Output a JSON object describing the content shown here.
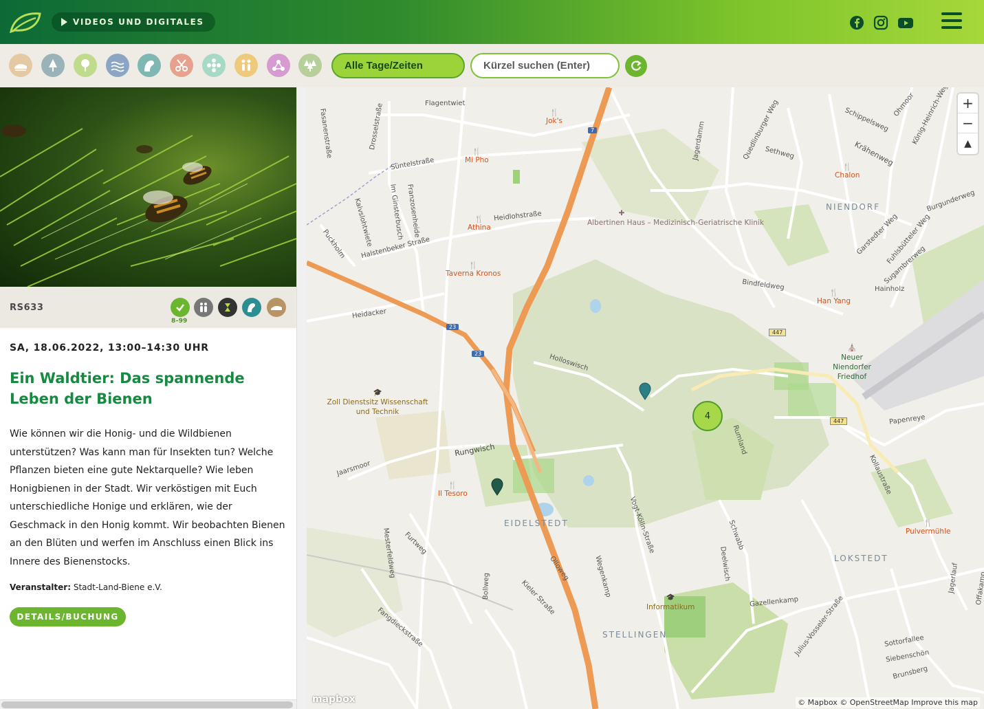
{
  "header": {
    "video_label": "VIDEOS UND DIGITALES"
  },
  "filters": {
    "days_label": "Alle Tage/Zeiten",
    "search_placeholder": "Kürzel suchen (Enter)"
  },
  "event": {
    "code": "RS633",
    "age_range": "8–99",
    "date": "SA, 18.06.2022, 13:00–14:30 UHR",
    "title": "Ein Waldtier: Das spannende Leben der Bienen",
    "description": "Wie können wir die Honig- und die Wildbienen unterstützen? Was kann man für Insekten tun? Welche Pflanzen bieten eine gute Nektarquelle? Wie leben Honigbienen in der Stadt. Wir verköstigen mit Euch unterschiedliche Honige und erklären, wie der Geschmack in den Honig kommt. Wir beobachten Bienen an den Blüten und werfen im Anschluss einen Blick ins Innere des Bienenstocks.",
    "organizer_label": "Veranstalter:",
    "organizer": "Stadt-Land-Biene e.V.",
    "details_button": "DETAILS/BUCHUNG"
  },
  "map": {
    "cluster_count": "4",
    "streets": [
      "Flagentwiet",
      "Fasanenstraße",
      "Drosselstraße",
      "Süntelstraße",
      "Im Ginsterbusch",
      "Franzosenheide",
      "Kalvslohtwiete",
      "Puckholm",
      "Halstenbeker Straße",
      "Heidlohstraße",
      "Heidacker",
      "Holloswisch",
      "Rungwisch",
      "Jaarsmoor",
      "Furtweg",
      "Mesterfeldweg",
      "Bollweg",
      "Fangdieckstraße",
      "Kieler Straße",
      "Olloweg",
      "Wegenkamp",
      "Vogt-Kölln-Straße",
      "Schwabb",
      "Deelwisch",
      "Gazellenkamp",
      "Julius-Vosseler-Straße",
      "Rumland",
      "Papenreye",
      "Kollaustraße",
      "Bindfeldweg",
      "Jagerdamm",
      "Quedlinburger Weg",
      "Sethweg",
      "Schippelsweg",
      "Krähenweg",
      "Ohmoor",
      "König-Heinrich-Weg",
      "Garstedter Weg",
      "Burgunderweg",
      "Fuhlsbütteler Weg",
      "Sugambrerweg",
      "Hainholz",
      "Sottorfallee",
      "Siebenschön",
      "Brunsberg",
      "Jagerlauf",
      "Offakamp"
    ],
    "pois": [
      "Jok's",
      "Mi Pho",
      "Athina",
      "Taverna Kronos",
      "Chalon",
      "Han Yang",
      "Il Tesoro",
      "Pulvermühle"
    ],
    "hospital": "Albertinen Haus – Medizinisch-Geriatrische Klinik",
    "zoll": "Zoll Dienstsitz Wissenschaft und Technik",
    "informatikum": "Informatikum",
    "friedhof": "Neuer Niendorfer Friedhof",
    "districts": [
      "NIENDORF",
      "EIDELSTEDT",
      "LOKSTEDT",
      "STELLINGEN"
    ],
    "road_shields": [
      "7",
      "23",
      "23",
      "447",
      "447"
    ],
    "attribution": "© Mapbox © OpenStreetMap  Improve this map",
    "mapbox_logo": "mapbox"
  }
}
